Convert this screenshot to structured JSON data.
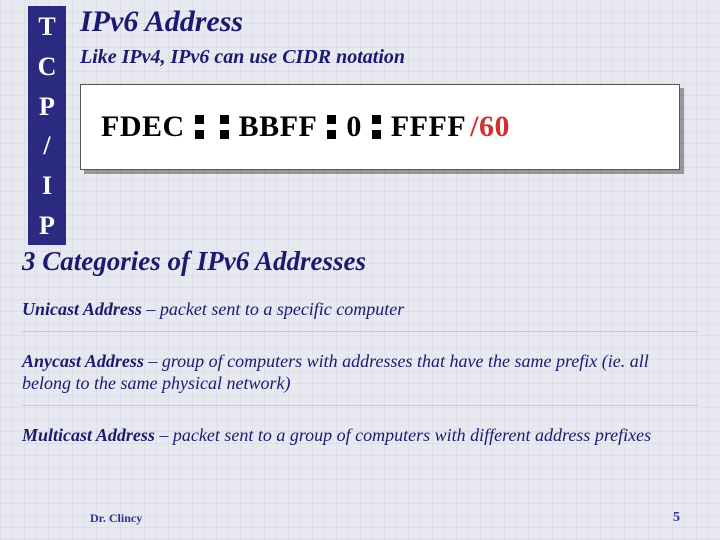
{
  "sidebar": {
    "letters": [
      "T",
      "C",
      "P",
      "/",
      "I",
      "P"
    ]
  },
  "title": "IPv6 Address",
  "subtitle": "Like IPv4, IPv6 can use CIDR notation",
  "address": {
    "seg1": "FDEC",
    "seg2": "BBFF",
    "seg3": "0",
    "seg4": "FFFF",
    "suffix": "/60"
  },
  "heading2": "3 Categories of IPv6 Addresses",
  "defs": [
    {
      "term": "Unicast Address",
      "desc": " – packet sent to a specific computer"
    },
    {
      "term": "Anycast Address",
      "desc": " – group of computers with addresses that have the same prefix (ie. all belong to the same physical network)"
    },
    {
      "term": "Multicast Address",
      "desc": " – packet sent to a group of computers with different address prefixes"
    }
  ],
  "footer": {
    "author": "Dr. Clincy",
    "page": "5"
  }
}
